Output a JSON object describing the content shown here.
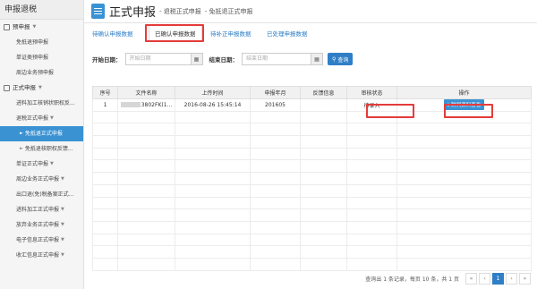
{
  "sidebar": {
    "title": "申报退税",
    "groups": [
      {
        "label": "预申报",
        "items": [
          "免抵退预申报",
          "单证类预申报",
          "周边业务预申报"
        ]
      },
      {
        "label": "正式申报",
        "items": [
          "进料加工核销状职权反...",
          "退税正式申报",
          "免抵退正式申报",
          "免抵退核职权反馈..."
        ]
      }
    ],
    "more_items": [
      "单证正式申报",
      "周边业务正式申报",
      "出口退(免)税备案正式...",
      "进料加工正式申报",
      "放弃业务正式申报",
      "电子信息正式申报",
      "收汇信息正式申报"
    ]
  },
  "header": {
    "title": "正式申报",
    "crumb_1": "- 退税正式申报",
    "crumb_2": "- 免抵退正式申报"
  },
  "tabs": [
    "待确认申报数据",
    "已确认申报数据",
    "待补正申报数据",
    "已处理申报数据"
  ],
  "filter": {
    "start_label": "开始日期：",
    "start_placeholder": "开始日期",
    "end_label": "结束日期：",
    "end_placeholder": "结束日期",
    "query_label": "查询"
  },
  "table": {
    "headers": [
      "序号",
      "文件名称",
      "上传时间",
      "申报年月",
      "反馈信息",
      "审核状态",
      "操作"
    ],
    "rows": [
      {
        "index": "1",
        "file_suffix": "3802FK(1...",
        "upload_time": "2016-08-26 15:45:14",
        "period": "201605",
        "feedback": "",
        "status": "待录入",
        "action": "附列资料查看"
      }
    ]
  },
  "pagination": {
    "info": "查询出 1 条记录，每页 10 条，共 1 页",
    "first": "«",
    "prev": "‹",
    "current": "1",
    "next": "›",
    "last": "»"
  },
  "colors": {
    "accent": "#3a92d3",
    "highlight": "#e53b3b"
  }
}
